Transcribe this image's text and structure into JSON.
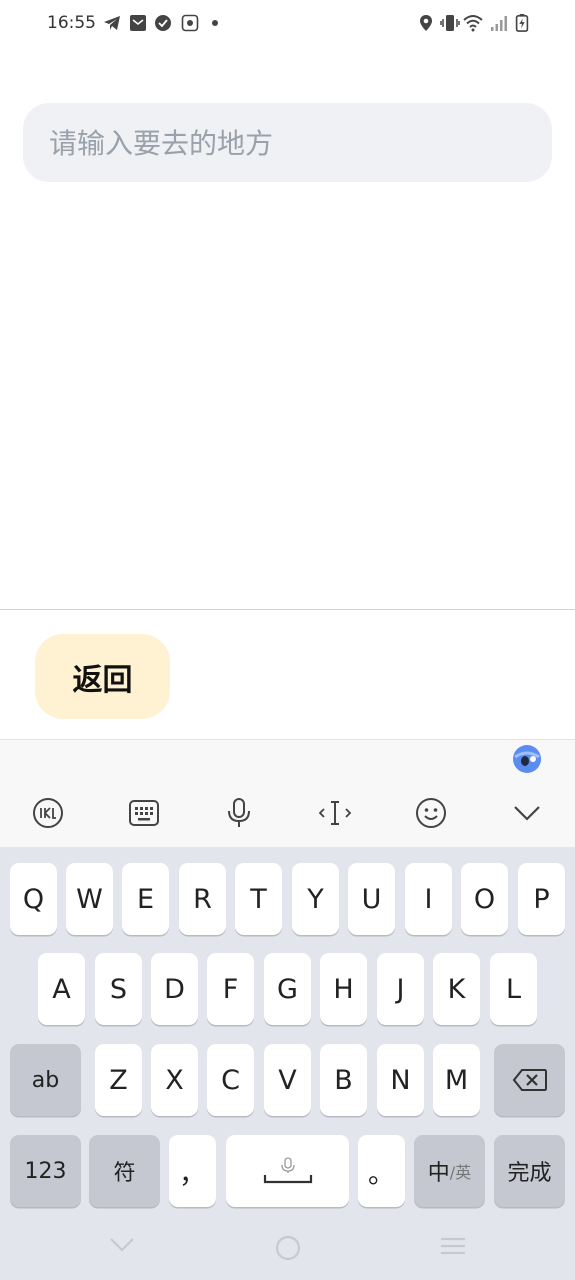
{
  "status_bar": {
    "time": "16:55",
    "icons": [
      "telegram-icon",
      "mail-icon",
      "check-circle-icon",
      "photo-icon",
      "dot-icon",
      "location-icon",
      "vibrate-icon",
      "wifi-icon",
      "signal-icon",
      "battery-charging-icon"
    ]
  },
  "search": {
    "placeholder": "请输入要去的地方",
    "value": ""
  },
  "actions": {
    "back_label": "返回"
  },
  "keyboard": {
    "toolbar_icons": [
      "ime-logo-icon",
      "keyboard-icon",
      "microphone-icon",
      "cursor-icon",
      "emoji-icon",
      "chevron-down-icon"
    ],
    "row1": [
      "Q",
      "W",
      "E",
      "R",
      "T",
      "Y",
      "U",
      "I",
      "O",
      "P"
    ],
    "row2": [
      "A",
      "S",
      "D",
      "F",
      "G",
      "H",
      "J",
      "K",
      "L"
    ],
    "row3": [
      "Z",
      "X",
      "C",
      "V",
      "B",
      "N",
      "M"
    ],
    "shift_label": "ab",
    "numbers_label": "123",
    "symbols_label": "符",
    "comma_label": "，",
    "period_label": "。",
    "lang_label": "中",
    "lang_suffix": "/英",
    "done_label": "完成"
  },
  "colors": {
    "back_button_bg": "#fff2d3",
    "search_bg": "#eff1f4",
    "keyboard_bg": "#e3e5ec"
  }
}
